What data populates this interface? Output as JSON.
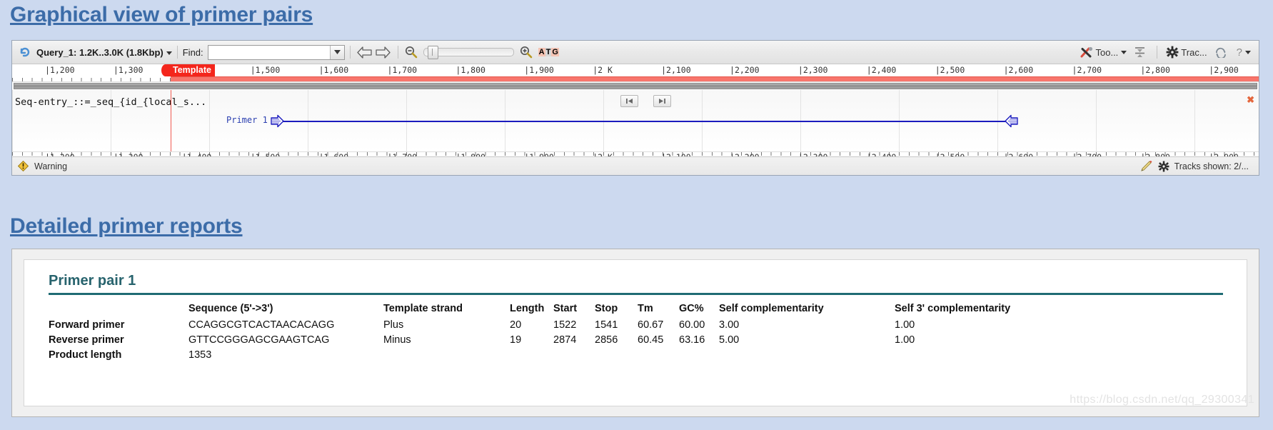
{
  "page": {
    "background_color": "#ccd9ef",
    "heading_color": "#3c6ca8"
  },
  "headings": {
    "graphical": "Graphical view of primer pairs",
    "reports": "Detailed primer reports"
  },
  "viewer": {
    "toolbar": {
      "undo_icon": "undo-icon",
      "range_selector": "Query_1: 1.2K..3.0K (1.8Kbp)",
      "find_label": "Find:",
      "find_value": "",
      "find_placeholder": "",
      "back_icon": "arrow-left-icon",
      "forward_icon": "arrow-right-icon",
      "zoom_out_icon": "zoom-out-icon",
      "zoom_in_icon": "zoom-in-icon",
      "sequence_icon": "atg-icon",
      "atg_letters": [
        "A",
        "T",
        "G"
      ],
      "tools_label": "Too...",
      "align_icon": "align-icon",
      "tracks_label": "Trac...",
      "reload_icon": "reload-icon",
      "help_label": "?"
    },
    "ruler": {
      "ticks": [
        "1,200",
        "1,300",
        "1,400",
        "1,500",
        "1,600",
        "1,700",
        "1,800",
        "1,900",
        "2 K",
        "2,100",
        "2,200",
        "2,300",
        "2,400",
        "2,500",
        "2,600",
        "2,700",
        "2,800",
        "2,900"
      ],
      "template_badge": "Template",
      "template_color": "#f4261c"
    },
    "tracks": {
      "sequence_title": "Seq-entry_::=_seq_{id_{local_s...",
      "primer_label": "Primer 1",
      "primer_color": "#1b1bbe",
      "nav_prev_icon": "skip-previous-icon",
      "nav_next_icon": "skip-next-icon",
      "close_icon": "close-icon"
    },
    "status": {
      "warning_icon": "warning-icon",
      "warning_text": "Warning",
      "edit_icon": "pencil-icon",
      "settings_icon": "gear-icon",
      "tracks_shown": "Tracks shown: 2/..."
    }
  },
  "report": {
    "pair_title": "Primer pair 1",
    "accent_color": "#1f6b74",
    "columns": [
      "",
      "Sequence (5'->3')",
      "Template strand",
      "Length",
      "Start",
      "Stop",
      "Tm",
      "GC%",
      "Self complementarity",
      "Self 3' complementarity"
    ],
    "rows": [
      {
        "label": "Forward primer",
        "sequence": "CCAGGCGTCACTAACACAGG",
        "strand": "Plus",
        "length": "20",
        "start": "1522",
        "stop": "1541",
        "tm": "60.67",
        "gc": "60.00",
        "self_comp": "3.00",
        "self3_comp": "1.00"
      },
      {
        "label": "Reverse primer",
        "sequence": "GTTCCGGGAGCGAAGTCAG",
        "strand": "Minus",
        "length": "19",
        "start": "2874",
        "stop": "2856",
        "tm": "60.45",
        "gc": "63.16",
        "self_comp": "5.00",
        "self3_comp": "1.00"
      }
    ],
    "product_length_label": "Product length",
    "product_length_value": "1353"
  },
  "watermark": "https://blog.csdn.net/qq_29300341"
}
